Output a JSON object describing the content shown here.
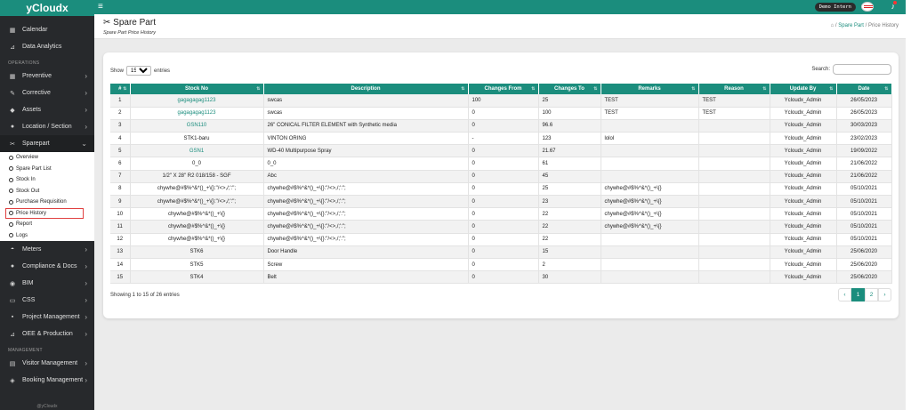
{
  "brand": "yCloudx",
  "sidebar": {
    "top": [
      {
        "label": "Calendar",
        "icon": "calendar-icon"
      },
      {
        "label": "Data Analytics",
        "icon": "chart-icon"
      }
    ],
    "operations_header": "OPERATIONS",
    "ops": [
      {
        "label": "Preventive",
        "icon": "calendar-icon"
      },
      {
        "label": "Corrective",
        "icon": "wrench-icon"
      },
      {
        "label": "Assets",
        "icon": "tag-icon"
      },
      {
        "label": "Location / Section",
        "icon": "location-icon"
      },
      {
        "label": "Sparepart",
        "icon": "scissors-icon"
      }
    ],
    "sparepart_sub": [
      "Overview",
      "Spare Part List",
      "Stock In",
      "Stock Out",
      "Purchase Requisition",
      "Price History",
      "Report",
      "Logs"
    ],
    "ops2": [
      {
        "label": "Meters",
        "icon": "meter-icon"
      },
      {
        "label": "Compliance & Docs",
        "icon": "document-icon"
      },
      {
        "label": "BIM",
        "icon": "bim-icon"
      },
      {
        "label": "CSS",
        "icon": "monitor-icon"
      },
      {
        "label": "Project Management",
        "icon": "project-icon"
      },
      {
        "label": "OEE & Production",
        "icon": "chart-icon"
      }
    ],
    "management_header": "MANAGEMENT",
    "mgmt": [
      {
        "label": "Visitor Management",
        "icon": "visitor-icon"
      },
      {
        "label": "Booking Management",
        "icon": "booking-icon"
      }
    ],
    "footer": "@yCloudx"
  },
  "topbar": {
    "user": "Demo Intern"
  },
  "header": {
    "title": "Spare Part",
    "subtitle": "Spare Part Price History",
    "crumb_part": "Spare Part",
    "crumb_current": "Price History"
  },
  "table": {
    "show_label": "Show",
    "entries_label": "entries",
    "page_size": "15",
    "search_label": "Search:",
    "columns": [
      "#",
      "Stock No",
      "Description",
      "Changes From",
      "Changes To",
      "Remarks",
      "Reason",
      "Update By",
      "Date"
    ],
    "rows": [
      [
        "1",
        "gagagagag1123",
        "swcas",
        "100",
        "25",
        "TEST",
        "TEST",
        "Ycloudx_Admin",
        "26/05/2023"
      ],
      [
        "2",
        "gagagagag1123",
        "swcas",
        "0",
        "100",
        "TEST",
        "TEST",
        "Ycloudx_Admin",
        "26/05/2023"
      ],
      [
        "3",
        "GSN110",
        "26\" CONICAL FILTER ELEMENT with Synthetic media",
        "0",
        "96.6",
        "",
        "",
        "Ycloudx_Admin",
        "30/03/2023"
      ],
      [
        "4",
        "STK1-baru",
        "VINTON ORING",
        "-",
        "123",
        "lolol",
        "",
        "Ycloudx_Admin",
        "23/02/2023"
      ],
      [
        "5",
        "GSN1",
        "WD-40 Multipurpose Spray",
        "0",
        "21.67",
        "",
        "",
        "Ycloudx_Admin",
        "19/09/2022"
      ],
      [
        "6",
        "0_0",
        "0_0",
        "0",
        "61",
        "",
        "",
        "Ycloudx_Admin",
        "21/06/2022"
      ],
      [
        "7",
        "1/2\" X 28\" R2 018/158 - SGF",
        "Abc",
        "0",
        "45",
        "",
        "",
        "Ycloudx_Admin",
        "21/06/2022"
      ],
      [
        "8",
        "chywhe@#$%^&*()_+\\{}:\"/<>,/;':\";",
        "chywhe@#$%^&*()_+\\{}:\"/<>,/;':\";",
        "0",
        "25",
        "chywhe@#$%^&*()_+\\{}",
        "",
        "Ycloudx_Admin",
        "05/10/2021"
      ],
      [
        "9",
        "chywhe@#$%^&*()_+\\{}:\"/<>,/;':\";",
        "chywhe@#$%^&*()_+\\{}:\"/<>,/;':\";",
        "0",
        "23",
        "chywhe@#$%^&*()_+\\{}",
        "",
        "Ycloudx_Admin",
        "05/10/2021"
      ],
      [
        "10",
        "chywhe@#$%^&*()_+\\{}",
        "chywhe@#$%^&*()_+\\{}:\"/<>,/;':\";",
        "0",
        "22",
        "chywhe@#$%^&*()_+\\{}",
        "",
        "Ycloudx_Admin",
        "05/10/2021"
      ],
      [
        "11",
        "chywhe@#$%^&*()_+\\{}",
        "chywhe@#$%^&*()_+\\{}:\"/<>,/;':\";",
        "0",
        "22",
        "chywhe@#$%^&*()_+\\{}",
        "",
        "Ycloudx_Admin",
        "05/10/2021"
      ],
      [
        "12",
        "chywhe@#$%^&*()_+\\{}",
        "chywhe@#$%^&*()_+\\{}:\"/<>,/;':\";",
        "0",
        "22",
        "",
        "",
        "Ycloudx_Admin",
        "05/10/2021"
      ],
      [
        "13",
        "STK6",
        "Door Handle",
        "0",
        "15",
        "",
        "",
        "Ycloudx_Admin",
        "25/06/2020"
      ],
      [
        "14",
        "STK5",
        "Screw",
        "0",
        "2",
        "",
        "",
        "Ycloudx_Admin",
        "25/06/2020"
      ],
      [
        "15",
        "STK4",
        "Belt",
        "0",
        "30",
        "",
        "",
        "Ycloudx_Admin",
        "25/06/2020"
      ]
    ],
    "linked_rows": [
      1,
      2,
      3,
      5
    ],
    "info": "Showing 1 to 15 of 26 entries",
    "pages": [
      "1",
      "2"
    ]
  },
  "colors": {
    "accent": "#1b8d7d",
    "sidebar": "#27292c"
  }
}
